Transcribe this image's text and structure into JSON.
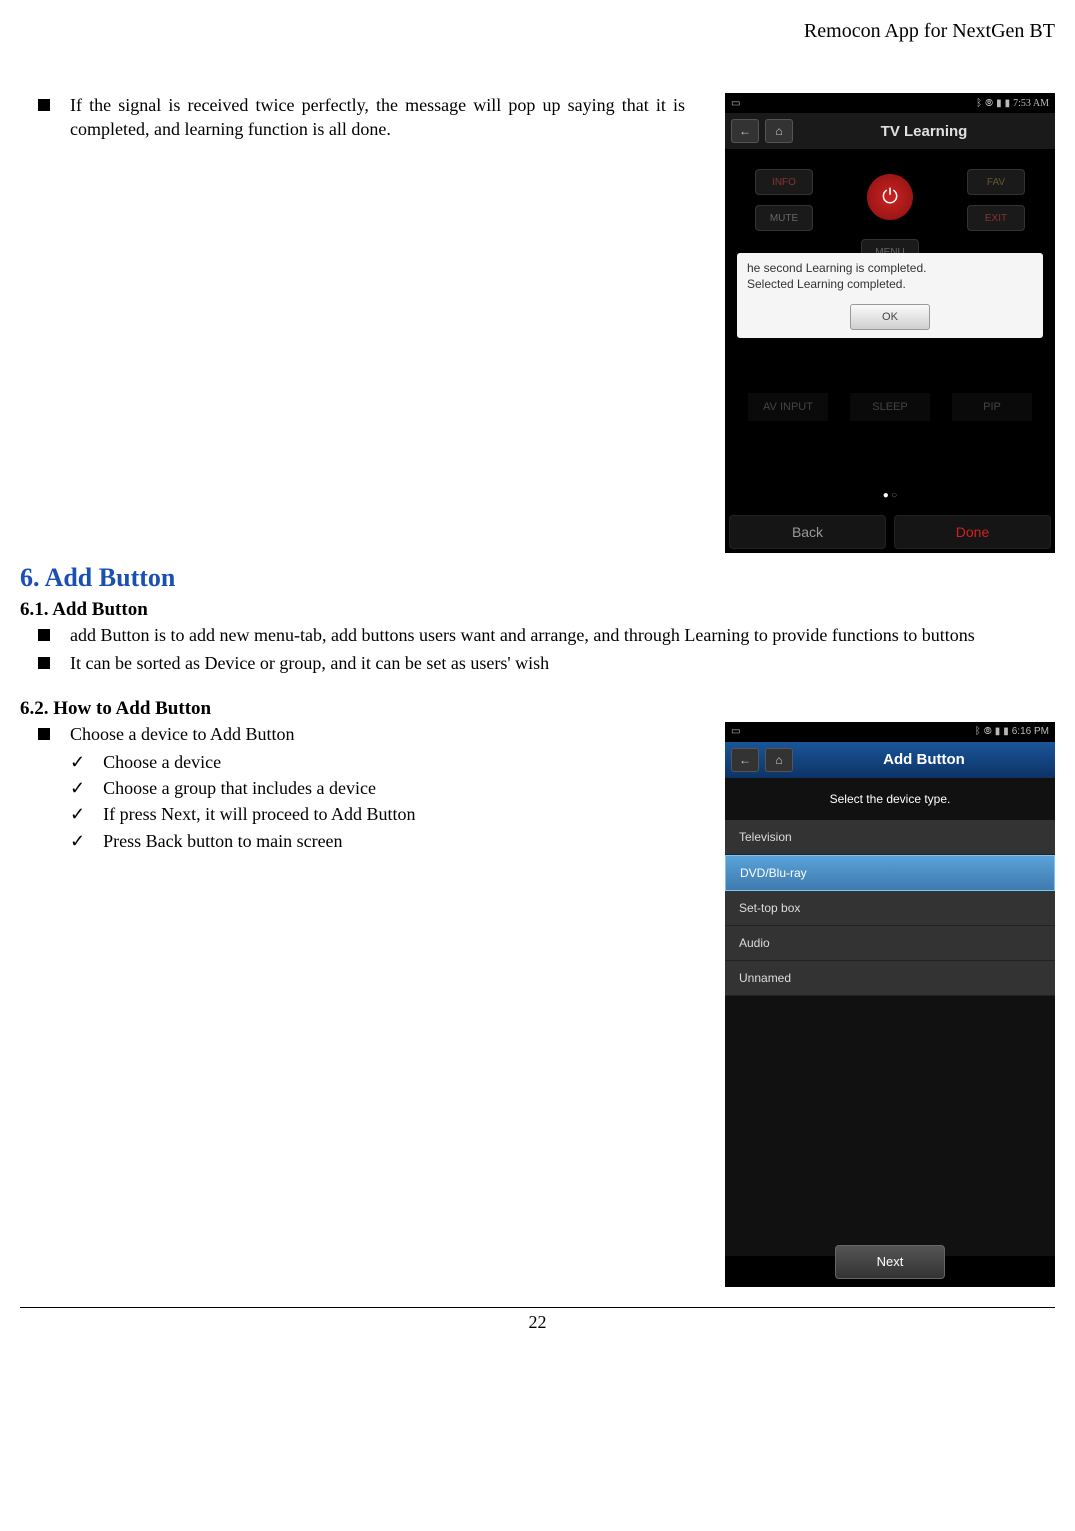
{
  "header": {
    "title": "Remocon App for NextGen BT"
  },
  "intro_bullet": "If the signal is received twice perfectly, the message will pop up saying that it is completed, and learning function is all done.",
  "phone1": {
    "status_time": "7:53 AM",
    "title": "TV Learning",
    "buttons": {
      "info": "INFO",
      "fav": "FAV",
      "mute": "MUTE",
      "exit": "EXIT",
      "menu": "MENU"
    },
    "dialog": {
      "line1": "he second Learning is completed.",
      "line2": "Selected Learning completed.",
      "ok": "OK"
    },
    "bottom": {
      "av": "AV INPUT",
      "sleep": "SLEEP",
      "pip": "PIP"
    },
    "footer": {
      "back": "Back",
      "done": "Done"
    }
  },
  "section6": {
    "title": "6. Add Button",
    "sub1": {
      "title": "6.1. Add Button",
      "items": [
        "add Button is to add new menu-tab, add buttons users want and arrange, and through Learning to provide functions to buttons",
        "It can be sorted as Device or group, and it can be set as users' wish"
      ]
    },
    "sub2": {
      "title": "6.2. How to Add Button",
      "lead": "Choose a device to Add Button",
      "checks": [
        "Choose a device",
        "Choose a group that includes a device",
        "If press Next, it will proceed to Add Button",
        "Press Back button to main screen"
      ]
    }
  },
  "phone2": {
    "status_time": "6:16 PM",
    "title": "Add Button",
    "instruction": "Select the device type.",
    "devices": [
      "Television",
      "DVD/Blu-ray",
      "Set-top box",
      "Audio",
      "Unnamed"
    ],
    "selected_index": 1,
    "next": "Next"
  },
  "page_number": "22"
}
